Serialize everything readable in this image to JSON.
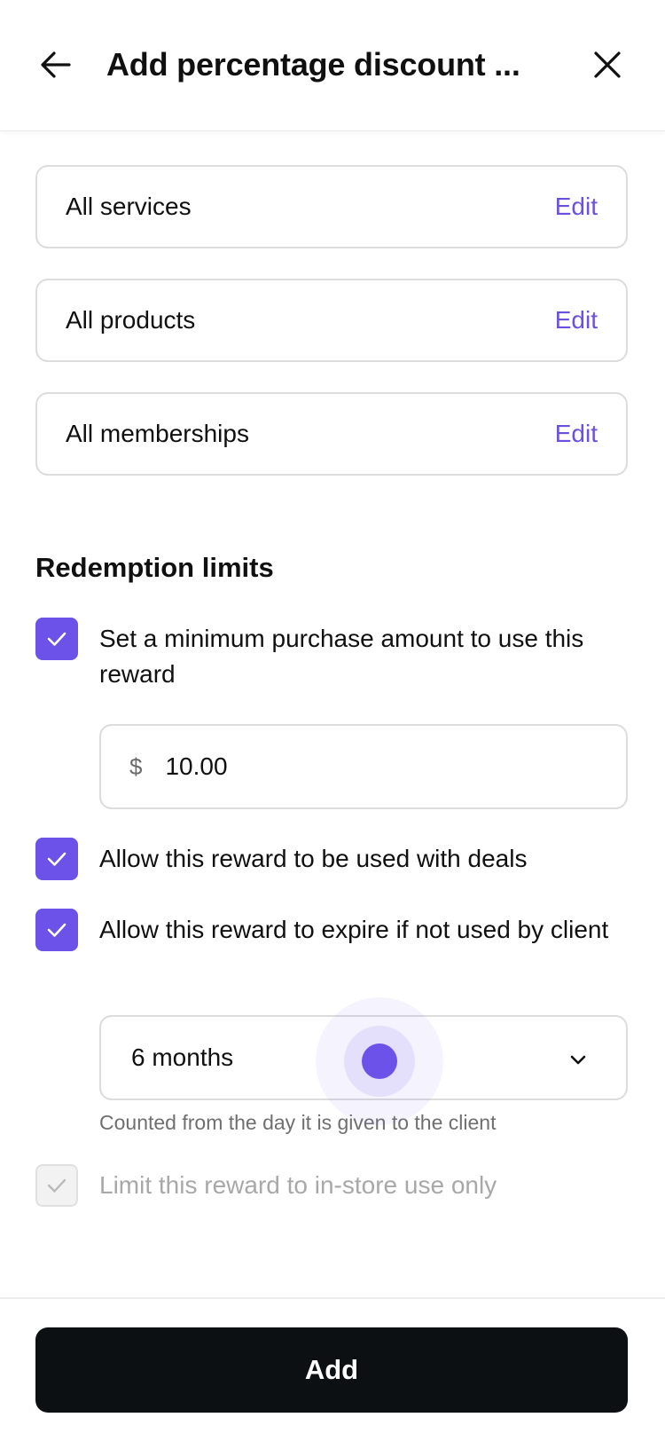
{
  "header": {
    "title": "Add percentage discount ...",
    "back_icon": "arrow-left-icon",
    "close_icon": "close-icon"
  },
  "categories": [
    {
      "label": "All services",
      "action": "Edit"
    },
    {
      "label": "All products",
      "action": "Edit"
    },
    {
      "label": "All memberships",
      "action": "Edit"
    }
  ],
  "redemption": {
    "title": "Redemption limits",
    "min_purchase": {
      "label": "Set a minimum purchase amount to use this reward",
      "checked": true,
      "currency": "$",
      "amount": "10.00"
    },
    "deals": {
      "label": "Allow this reward to be used with deals",
      "checked": true
    },
    "expire": {
      "label": "Allow this reward to expire if not used by client",
      "checked": true,
      "selected": "6 months",
      "helper": "Counted from the day it is given to the client"
    },
    "in_store": {
      "label": "Limit this reward to in-store use only",
      "checked": true,
      "disabled": true
    }
  },
  "footer": {
    "add_label": "Add"
  },
  "colors": {
    "accent": "#6c52e8",
    "link": "#6a4fe0",
    "primary_button": "#0d1012"
  }
}
